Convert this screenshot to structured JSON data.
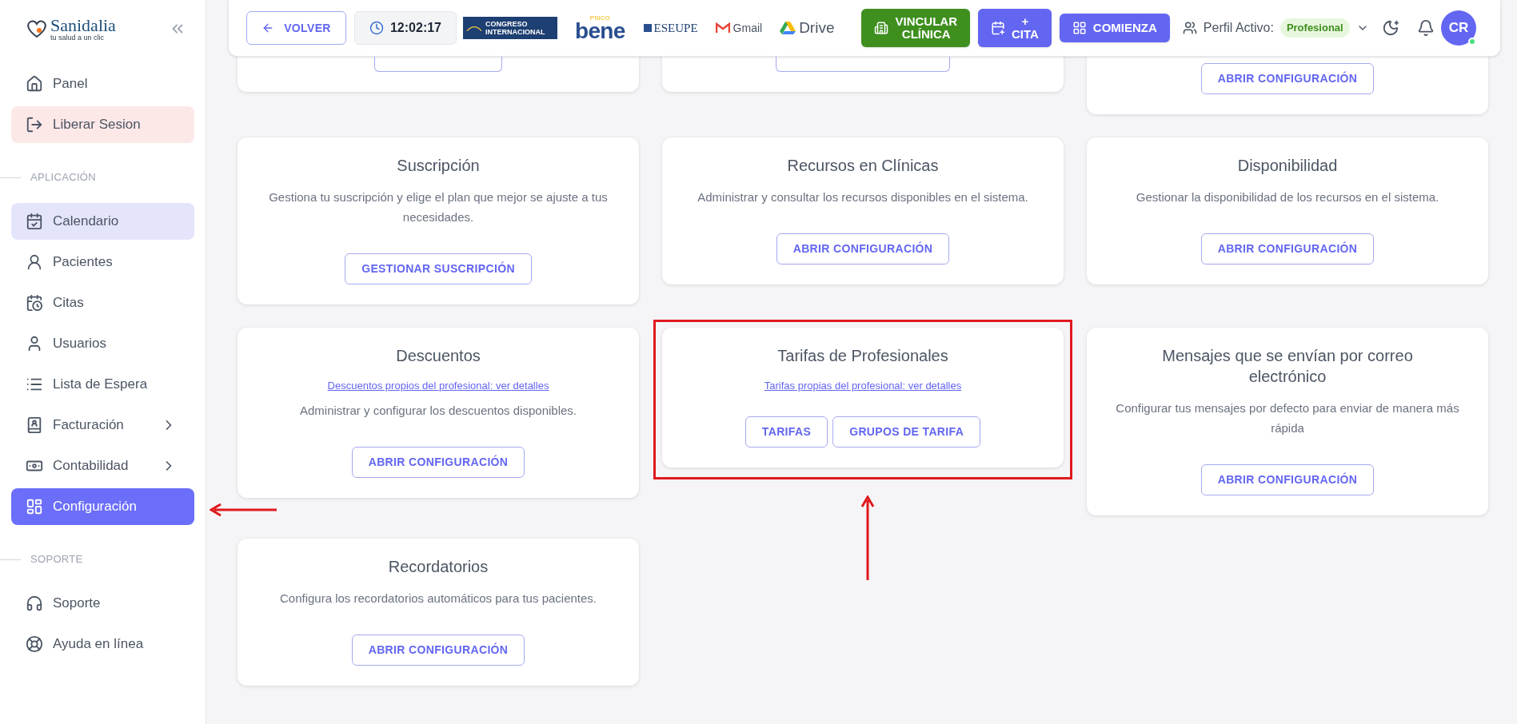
{
  "sidebar": {
    "logo": {
      "name": "Sanidalia",
      "tagline": "tu salud a un clic"
    },
    "sections": [
      {
        "items": [
          {
            "label": "Panel",
            "kind": "plain",
            "selected": false,
            "submenu": false
          },
          {
            "label": "Liberar Sesion",
            "kind": "danger",
            "selected": false,
            "submenu": false
          }
        ]
      },
      {
        "title": "APLICACIÓN",
        "items": [
          {
            "label": "Calendario",
            "kind": "soft",
            "selected": false,
            "submenu": false
          },
          {
            "label": "Pacientes",
            "kind": "plain",
            "selected": false,
            "submenu": false
          },
          {
            "label": "Citas",
            "kind": "plain",
            "selected": false,
            "submenu": false
          },
          {
            "label": "Usuarios",
            "kind": "plain",
            "selected": false,
            "submenu": false
          },
          {
            "label": "Lista de Espera",
            "kind": "plain",
            "selected": false,
            "submenu": false
          },
          {
            "label": "Facturación",
            "kind": "plain",
            "selected": false,
            "submenu": true
          },
          {
            "label": "Contabilidad",
            "kind": "plain",
            "selected": false,
            "submenu": true
          },
          {
            "label": "Configuración",
            "selected": true,
            "submenu": false
          }
        ]
      },
      {
        "title": "SOPORTE",
        "items": [
          {
            "label": "Soporte",
            "kind": "plain",
            "selected": false,
            "submenu": false
          },
          {
            "label": "Ayuda en línea",
            "kind": "plain",
            "selected": false,
            "submenu": false
          }
        ]
      }
    ]
  },
  "header": {
    "back_button": "VOLVER",
    "clock": "12:02:17",
    "logos": [
      {
        "kind": "congreso",
        "text": "CONGRESO INTERNACIONAL"
      },
      {
        "kind": "bene",
        "text": "bene",
        "small": "PSICO"
      },
      {
        "kind": "eseupe",
        "text": "ESEUPE"
      },
      {
        "kind": "gmail",
        "text": "Gmail"
      },
      {
        "kind": "drive",
        "text": "Drive"
      }
    ],
    "buttons": [
      {
        "label": "VINCULAR CLÍNICA",
        "color": "#3f8f1f"
      },
      {
        "label": "+ CITA",
        "color": "#6366f1"
      },
      {
        "label": "COMIENZA",
        "color": "#6366f1"
      }
    ],
    "profile": {
      "label": "Perfil Activo:",
      "badge": "Profesional"
    },
    "avatar": {
      "initials": "CR",
      "online": true
    }
  },
  "cards": [
    {
      "kind": "covered"
    },
    {
      "kind": "covered"
    },
    {
      "buttons": [
        "ABRIR CONFIGURACIÓN"
      ]
    },
    {
      "title": "Suscripción",
      "description": "Gestiona tu suscripción y elige el plan que mejor se ajuste a tus necesidades.",
      "buttons": [
        "GESTIONAR SUSCRIPCIÓN"
      ]
    },
    {
      "title": "Recursos en Clínicas",
      "description": "Administrar y consultar los recursos disponibles en el sistema.",
      "buttons": [
        "ABRIR CONFIGURACIÓN"
      ]
    },
    {
      "title": "Disponibilidad",
      "description": "Gestionar la disponibilidad de los recursos en el sistema.",
      "buttons": [
        "ABRIR CONFIGURACIÓN"
      ]
    },
    {
      "title": "Descuentos",
      "link": "Descuentos propios del profesional: ver detalles",
      "description": "Administrar y configurar los descuentos disponibles.",
      "buttons": [
        "ABRIR CONFIGURACIÓN"
      ]
    },
    {
      "title": "Tarifas de Profesionales",
      "link": "Tarifas propias del profesional: ver detalles",
      "buttons": [
        "TARIFAS",
        "GRUPOS DE TARIFA"
      ],
      "highlighted": true
    },
    {
      "title": "Mensajes que se envían por correo electrónico",
      "description": "Configurar tus mensajes por defecto para enviar de manera más rápida",
      "buttons": [
        "ABRIR CONFIGURACIÓN"
      ]
    },
    {
      "title": "Recordatorios",
      "description": "Configura los recordatorios automáticos para tus pacientes.",
      "buttons": [
        "ABRIR CONFIGURACIÓN"
      ]
    }
  ]
}
